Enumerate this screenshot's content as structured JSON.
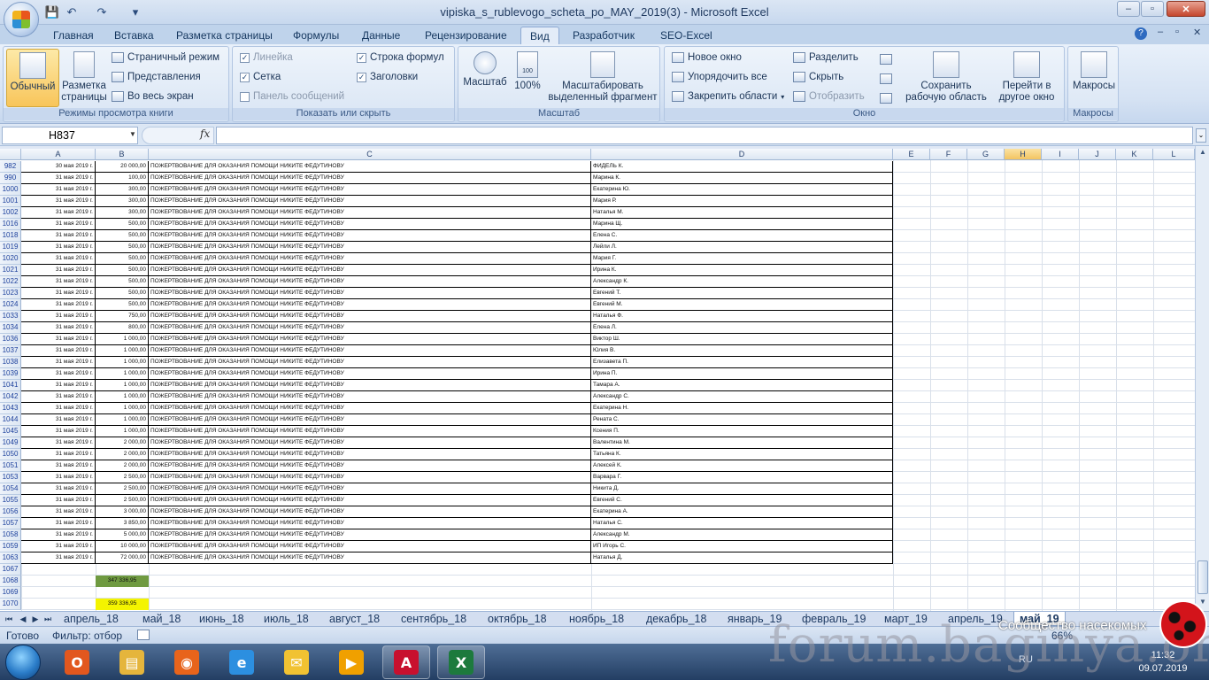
{
  "window": {
    "title": "vipiska_s_rublevogo_scheta_po_MAY_2019(3) - Microsoft Excel",
    "controls": [
      "–",
      "▫",
      "✕"
    ],
    "doc_controls": [
      "–",
      "▫",
      "✕"
    ],
    "help": "?"
  },
  "quick_access": {
    "save": "💾",
    "undo": "↶",
    "redo": "↷",
    "customize": "▾"
  },
  "tabs": [
    "Главная",
    "Вставка",
    "Разметка страницы",
    "Формулы",
    "Данные",
    "Рецензирование",
    "Вид",
    "Разработчик",
    "SEO-Excel"
  ],
  "active_tab": "Вид",
  "ribbon": {
    "views": {
      "label": "Режимы просмотра книги",
      "normal": "Обычный",
      "page_layout_1": "Разметка",
      "page_layout_2": "страницы",
      "page_break": "Страничный режим",
      "custom_views": "Представления",
      "full_screen": "Во весь экран"
    },
    "show_hide": {
      "label": "Показать или скрыть",
      "ruler": "Линейка",
      "gridlines": "Сетка",
      "message_bar": "Панель сообщений",
      "formula_bar": "Строка формул",
      "headings": "Заголовки",
      "check": "✓"
    },
    "zoom": {
      "label": "Масштаб",
      "zoom": "Масштаб",
      "hundred": "100%",
      "zoom_sel_1": "Масштабировать",
      "zoom_sel_2": "выделенный фрагмент",
      "icon_100": "100"
    },
    "window": {
      "label": "Окно",
      "new_window": "Новое окно",
      "arrange_all": "Упорядочить все",
      "freeze_panes": "Закрепить области",
      "split": "Разделить",
      "hide": "Скрыть",
      "unhide": "Отобразить",
      "save_ws_1": "Сохранить",
      "save_ws_2": "рабочую область",
      "switch_1": "Перейти в",
      "switch_2": "другое окно"
    },
    "macros": {
      "label": "Макросы",
      "button": "Макросы"
    }
  },
  "formula_bar": {
    "name_box": "H837",
    "fx": "fx",
    "formula": ""
  },
  "columns": [
    "A",
    "B",
    "C",
    "D",
    "E",
    "F",
    "G",
    "H",
    "I",
    "J",
    "K",
    "L"
  ],
  "selected_column": "H",
  "rows": [
    {
      "n": "982",
      "a": "30 мая 2019 г.",
      "b": "20 000,00",
      "c": "ПОЖЕРТВОВАНИЕ ДЛЯ ОКАЗАНИЯ ПОМОЩИ НИКИТЕ ФЕДУТИНОВУ",
      "d": "ФИДЕЛЬ К."
    },
    {
      "n": "990",
      "a": "31 мая 2019 г.",
      "b": "100,00",
      "c": "ПОЖЕРТВОВАНИЕ ДЛЯ ОКАЗАНИЯ ПОМОЩИ НИКИТЕ ФЕДУТИНОВУ",
      "d": "Марина К."
    },
    {
      "n": "1000",
      "a": "31 мая 2019 г.",
      "b": "300,00",
      "c": "ПОЖЕРТВОВАНИЕ ДЛЯ ОКАЗАНИЯ ПОМОЩИ НИКИТЕ ФЕДУТИНОВУ",
      "d": "Екатерина Ю."
    },
    {
      "n": "1001",
      "a": "31 мая 2019 г.",
      "b": "300,00",
      "c": "ПОЖЕРТВОВАНИЕ ДЛЯ ОКАЗАНИЯ ПОМОЩИ НИКИТЕ ФЕДУТИНОВУ",
      "d": "Мария Р."
    },
    {
      "n": "1002",
      "a": "31 мая 2019 г.",
      "b": "300,00",
      "c": "ПОЖЕРТВОВАНИЕ ДЛЯ ОКАЗАНИЯ ПОМОЩИ НИКИТЕ ФЕДУТИНОВУ",
      "d": "Наталья М."
    },
    {
      "n": "1016",
      "a": "31 мая 2019 г.",
      "b": "500,00",
      "c": "ПОЖЕРТВОВАНИЕ ДЛЯ ОКАЗАНИЯ ПОМОЩИ НИКИТЕ ФЕДУТИНОВУ",
      "d": "Марина Щ."
    },
    {
      "n": "1018",
      "a": "31 мая 2019 г.",
      "b": "500,00",
      "c": "ПОЖЕРТВОВАНИЕ ДЛЯ ОКАЗАНИЯ ПОМОЩИ НИКИТЕ ФЕДУТИНОВУ",
      "d": "Елена С."
    },
    {
      "n": "1019",
      "a": "31 мая 2019 г.",
      "b": "500,00",
      "c": "ПОЖЕРТВОВАНИЕ ДЛЯ ОКАЗАНИЯ ПОМОЩИ НИКИТЕ ФЕДУТИНОВУ",
      "d": "Лейли Л."
    },
    {
      "n": "1020",
      "a": "31 мая 2019 г.",
      "b": "500,00",
      "c": "ПОЖЕРТВОВАНИЕ ДЛЯ ОКАЗАНИЯ ПОМОЩИ НИКИТЕ ФЕДУТИНОВУ",
      "d": "Мария Г."
    },
    {
      "n": "1021",
      "a": "31 мая 2019 г.",
      "b": "500,00",
      "c": "ПОЖЕРТВОВАНИЕ ДЛЯ ОКАЗАНИЯ ПОМОЩИ НИКИТЕ ФЕДУТИНОВУ",
      "d": "Ирина К."
    },
    {
      "n": "1022",
      "a": "31 мая 2019 г.",
      "b": "500,00",
      "c": "ПОЖЕРТВОВАНИЕ ДЛЯ ОКАЗАНИЯ ПОМОЩИ НИКИТЕ ФЕДУТИНОВУ",
      "d": "Александр К."
    },
    {
      "n": "1023",
      "a": "31 мая 2019 г.",
      "b": "500,00",
      "c": "ПОЖЕРТВОВАНИЕ ДЛЯ ОКАЗАНИЯ ПОМОЩИ НИКИТЕ ФЕДУТИНОВУ",
      "d": "Евгений Т."
    },
    {
      "n": "1024",
      "a": "31 мая 2019 г.",
      "b": "500,00",
      "c": "ПОЖЕРТВОВАНИЕ ДЛЯ ОКАЗАНИЯ ПОМОЩИ НИКИТЕ ФЕДУТИНОВУ",
      "d": "Евгений М."
    },
    {
      "n": "1033",
      "a": "31 мая 2019 г.",
      "b": "750,00",
      "c": "ПОЖЕРТВОВАНИЕ ДЛЯ ОКАЗАНИЯ ПОМОЩИ НИКИТЕ ФЕДУТИНОВУ",
      "d": "Наталья Ф."
    },
    {
      "n": "1034",
      "a": "31 мая 2019 г.",
      "b": "800,00",
      "c": "ПОЖЕРТВОВАНИЕ ДЛЯ ОКАЗАНИЯ ПОМОЩИ НИКИТЕ ФЕДУТИНОВУ",
      "d": "Елена Л."
    },
    {
      "n": "1036",
      "a": "31 мая 2019 г.",
      "b": "1 000,00",
      "c": "ПОЖЕРТВОВАНИЕ ДЛЯ ОКАЗАНИЯ ПОМОЩИ НИКИТЕ ФЕДУТИНОВУ",
      "d": "Виктор Ш."
    },
    {
      "n": "1037",
      "a": "31 мая 2019 г.",
      "b": "1 000,00",
      "c": "ПОЖЕРТВОВАНИЕ ДЛЯ ОКАЗАНИЯ ПОМОЩИ НИКИТЕ ФЕДУТИНОВУ",
      "d": "Юлия В."
    },
    {
      "n": "1038",
      "a": "31 мая 2019 г.",
      "b": "1 000,00",
      "c": "ПОЖЕРТВОВАНИЕ ДЛЯ ОКАЗАНИЯ ПОМОЩИ НИКИТЕ ФЕДУТИНОВУ",
      "d": "Елизавета П."
    },
    {
      "n": "1039",
      "a": "31 мая 2019 г.",
      "b": "1 000,00",
      "c": "ПОЖЕРТВОВАНИЕ ДЛЯ ОКАЗАНИЯ ПОМОЩИ НИКИТЕ ФЕДУТИНОВУ",
      "d": "Ирина П."
    },
    {
      "n": "1041",
      "a": "31 мая 2019 г.",
      "b": "1 000,00",
      "c": "ПОЖЕРТВОВАНИЕ ДЛЯ ОКАЗАНИЯ ПОМОЩИ НИКИТЕ ФЕДУТИНОВУ",
      "d": "Тамара А."
    },
    {
      "n": "1042",
      "a": "31 мая 2019 г.",
      "b": "1 000,00",
      "c": "ПОЖЕРТВОВАНИЕ ДЛЯ ОКАЗАНИЯ ПОМОЩИ НИКИТЕ ФЕДУТИНОВУ",
      "d": "Александр С."
    },
    {
      "n": "1043",
      "a": "31 мая 2019 г.",
      "b": "1 000,00",
      "c": "ПОЖЕРТВОВАНИЕ ДЛЯ ОКАЗАНИЯ ПОМОЩИ НИКИТЕ ФЕДУТИНОВУ",
      "d": "Екатерина Н."
    },
    {
      "n": "1044",
      "a": "31 мая 2019 г.",
      "b": "1 000,00",
      "c": "ПОЖЕРТВОВАНИЕ ДЛЯ ОКАЗАНИЯ ПОМОЩИ НИКИТЕ ФЕДУТИНОВУ",
      "d": "Рената С."
    },
    {
      "n": "1045",
      "a": "31 мая 2019 г.",
      "b": "1 000,00",
      "c": "ПОЖЕРТВОВАНИЕ ДЛЯ ОКАЗАНИЯ ПОМОЩИ НИКИТЕ ФЕДУТИНОВУ",
      "d": "Ксения П."
    },
    {
      "n": "1049",
      "a": "31 мая 2019 г.",
      "b": "2 000,00",
      "c": "ПОЖЕРТВОВАНИЕ ДЛЯ ОКАЗАНИЯ ПОМОЩИ НИКИТЕ ФЕДУТИНОВУ",
      "d": "Валентина М."
    },
    {
      "n": "1050",
      "a": "31 мая 2019 г.",
      "b": "2 000,00",
      "c": "ПОЖЕРТВОВАНИЕ ДЛЯ ОКАЗАНИЯ ПОМОЩИ НИКИТЕ ФЕДУТИНОВУ",
      "d": "Татьяна К."
    },
    {
      "n": "1051",
      "a": "31 мая 2019 г.",
      "b": "2 000,00",
      "c": "ПОЖЕРТВОВАНИЕ ДЛЯ ОКАЗАНИЯ ПОМОЩИ НИКИТЕ ФЕДУТИНОВУ",
      "d": "Алексей К."
    },
    {
      "n": "1053",
      "a": "31 мая 2019 г.",
      "b": "2 500,00",
      "c": "ПОЖЕРТВОВАНИЕ ДЛЯ ОКАЗАНИЯ ПОМОЩИ НИКИТЕ ФЕДУТИНОВУ",
      "d": "Варвара Г."
    },
    {
      "n": "1054",
      "a": "31 мая 2019 г.",
      "b": "2 500,00",
      "c": "ПОЖЕРТВОВАНИЕ ДЛЯ ОКАЗАНИЯ ПОМОЩИ НИКИТЕ ФЕДУТИНОВУ",
      "d": "Никита Д."
    },
    {
      "n": "1055",
      "a": "31 мая 2019 г.",
      "b": "2 500,00",
      "c": "ПОЖЕРТВОВАНИЕ ДЛЯ ОКАЗАНИЯ ПОМОЩИ НИКИТЕ ФЕДУТИНОВУ",
      "d": "Евгений С."
    },
    {
      "n": "1056",
      "a": "31 мая 2019 г.",
      "b": "3 000,00",
      "c": "ПОЖЕРТВОВАНИЕ ДЛЯ ОКАЗАНИЯ ПОМОЩИ НИКИТЕ ФЕДУТИНОВУ",
      "d": "Екатерина А."
    },
    {
      "n": "1057",
      "a": "31 мая 2019 г.",
      "b": "3 850,00",
      "c": "ПОЖЕРТВОВАНИЕ ДЛЯ ОКАЗАНИЯ ПОМОЩИ НИКИТЕ ФЕДУТИНОВУ",
      "d": "Наталья С."
    },
    {
      "n": "1058",
      "a": "31 мая 2019 г.",
      "b": "5 000,00",
      "c": "ПОЖЕРТВОВАНИЕ ДЛЯ ОКАЗАНИЯ ПОМОЩИ НИКИТЕ ФЕДУТИНОВУ",
      "d": "Александр М."
    },
    {
      "n": "1059",
      "a": "31 мая 2019 г.",
      "b": "10 000,00",
      "c": "ПОЖЕРТВОВАНИЕ ДЛЯ ОКАЗАНИЯ ПОМОЩИ НИКИТЕ ФЕДУТИНОВУ",
      "d": "ИП Игорь С."
    },
    {
      "n": "1063",
      "a": "31 мая 2019 г.",
      "b": "72 000,00",
      "c": "ПОЖЕРТВОВАНИЕ ДЛЯ ОКАЗАНИЯ ПОМОЩИ НИКИТЕ ФЕДУТИНОВУ",
      "d": "Наталья Д."
    }
  ],
  "tail_rows": [
    {
      "n": "1067",
      "b": "",
      "fill": ""
    },
    {
      "n": "1068",
      "b": "347 336,95",
      "fill": "#6f9a40"
    },
    {
      "n": "1069",
      "b": "",
      "fill": ""
    },
    {
      "n": "1070",
      "b": "359 336,95",
      "fill": "#f4f400"
    }
  ],
  "sheet_nav": [
    "⏮",
    "◀",
    "▶",
    "⏭"
  ],
  "sheets": [
    "апрель_18",
    "май_18",
    "июнь_18",
    "июль_18",
    "август_18",
    "сентябрь_18",
    "октябрь_18",
    "ноябрь_18",
    "декабрь_18",
    "январь_19",
    "февраль_19",
    "март_19",
    "апрель_19",
    "май_19"
  ],
  "active_sheet": "май_19",
  "status": {
    "ready": "Готово",
    "filter": "Фильтр: отбор",
    "zoom": "66%"
  },
  "taskbar": {
    "apps": [
      {
        "name": "office-app",
        "glyph": "O",
        "color": "#e2571e",
        "open": false
      },
      {
        "name": "explorer",
        "glyph": "▤",
        "color": "#e5b53c",
        "open": false
      },
      {
        "name": "firefox",
        "glyph": "◉",
        "color": "#e8641b",
        "open": false
      },
      {
        "name": "internet-explorer",
        "glyph": "e",
        "color": "#2c8fe0",
        "open": false
      },
      {
        "name": "outlook",
        "glyph": "✉",
        "color": "#f1c232",
        "open": false
      },
      {
        "name": "media-player",
        "glyph": "▶",
        "color": "#f0a000",
        "open": false
      },
      {
        "name": "acrobat",
        "glyph": "A",
        "color": "#c8102e",
        "open": true
      },
      {
        "name": "excel",
        "glyph": "X",
        "color": "#1d7a3d",
        "open": true
      }
    ],
    "lang": "RU",
    "time": "11:32",
    "date": "09.07.2019"
  },
  "watermark": {
    "big": "forum.baginya.org",
    "small": "Сообщество насекомых"
  }
}
